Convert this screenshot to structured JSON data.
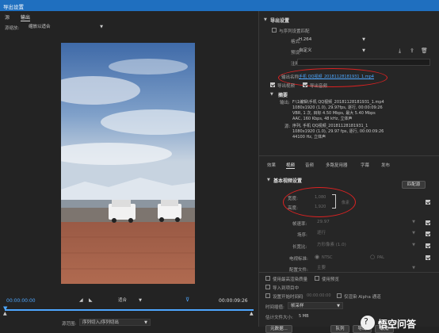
{
  "window": {
    "title": "导出设置"
  },
  "left": {
    "tabs": [
      "源",
      "输出"
    ],
    "source_scaling_label": "源缩放:",
    "source_scaling_value": "缩放以适合",
    "timecode_start": "00:00:00:00",
    "timecode_end": "00:00:09:26",
    "fit_label": "适合",
    "source_range_label": "源范围:",
    "source_range_value": "序列切入/序列切出",
    "playhead_progress": 0.0
  },
  "export_settings": {
    "section_title": "导出设置",
    "match_sequence_label": "与序列设置匹配",
    "format_label": "格式:",
    "format_value": "H.264",
    "preset_label": "预设:",
    "preset_value": "自定义",
    "comment_label": "注释:",
    "output_name_label": "输出名称:",
    "output_name_value": "手机 QQ视频_20181128181931_1.mp4",
    "export_video_label": "导出视频",
    "export_audio_label": "导出音频"
  },
  "summary": {
    "title": "摘要",
    "output_label": "输出:",
    "output_lines": [
      "F:\\1编辑\\手机 QQ视频_20181128181931_1.mp4",
      "1080x1920 (1.0), 29.97fps, 逐行, 00:00:09:26",
      "VBR, 1 次, 目标 4.50 Mbps, 最大 5.40 Mbps",
      "AAC, 160 Kbps, 48 kHz, 立体声"
    ],
    "source_label": "源:",
    "source_lines": [
      "序列, 手机 QQ视频_20181128181931_1",
      "1080x1920 (1.0), 29.97 fps, 逐行, 00:00:09:26",
      "44100 Hz, 立体声"
    ]
  },
  "right_tabs": [
    "效果",
    "视频",
    "音频",
    "多路复用器",
    "字幕",
    "发布"
  ],
  "video": {
    "section_title": "基本视频设置",
    "match_source_button": "匹配源",
    "width_label": "宽度:",
    "width_value": "1,080",
    "height_label": "高度:",
    "height_value": "1,920",
    "link_label": "像素",
    "frame_rate_label": "帧速率:",
    "frame_rate_value": "29.97",
    "field_order_label": "场序:",
    "field_order_value": "逐行",
    "aspect_label": "长宽比:",
    "aspect_value": "方形像素 (1.0)",
    "tv_standard_label": "电视标准:",
    "ntsc_label": "NTSC",
    "pal_label": "PAL",
    "profile_label": "配置文件:",
    "profile_value": "主要"
  },
  "bottom": {
    "max_render_label": "使用最高渲染质量",
    "use_preview_label": "使用预览",
    "import_project_label": "导入到项目中",
    "set_start_tc_label": "设置开始时间码",
    "start_tc_value": "00:00:00:00",
    "render_alpha_label": "仅渲染 Alpha 通道",
    "time_interp_label": "时间插值:",
    "time_interp_value": "帧采样",
    "file_size_label": "估计文件大小:",
    "file_size_value": "5 MB",
    "metadata_button": "元数据...",
    "queue_button": "队列",
    "export_button": "导出",
    "cancel_button": "取消"
  },
  "watermark": {
    "text": "悟空问答"
  },
  "colors": {
    "title_bar": "#1f6fbf",
    "accent_blue": "#4ea7ff",
    "annotation_red": "#dd2222"
  }
}
